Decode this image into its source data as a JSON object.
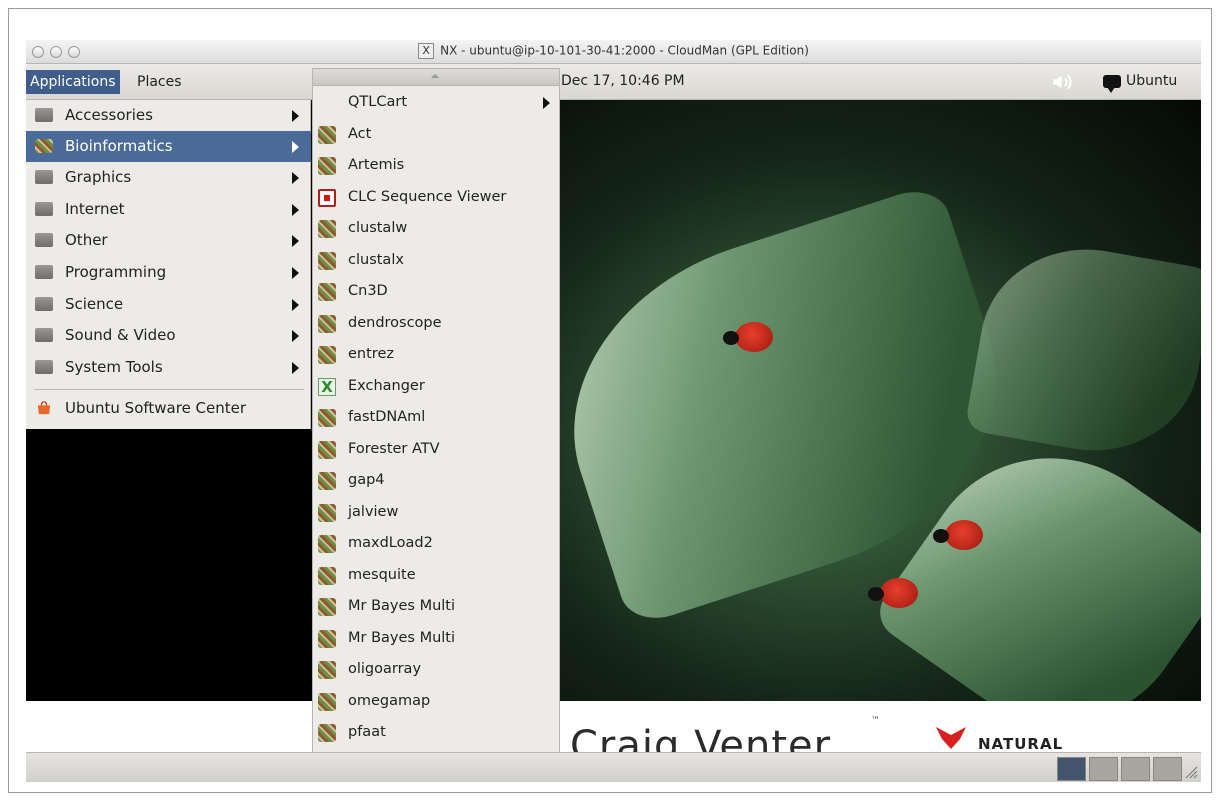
{
  "window": {
    "title": "NX - ubuntu@ip-10-101-30-41:2000 - CloudMan (GPL Edition)"
  },
  "panel": {
    "applications_label": "Applications",
    "places_label": "Places",
    "clock": "Dec 17, 10:46 PM",
    "user": "Ubuntu"
  },
  "app_menu": {
    "items": [
      {
        "label": "Accessories",
        "icon": "accessories-icon",
        "has_submenu": true
      },
      {
        "label": "Bioinformatics",
        "icon": "dna-icon",
        "has_submenu": true,
        "selected": true
      },
      {
        "label": "Graphics",
        "icon": "graphics-icon",
        "has_submenu": true
      },
      {
        "label": "Internet",
        "icon": "internet-icon",
        "has_submenu": true
      },
      {
        "label": "Other",
        "icon": "other-icon",
        "has_submenu": true
      },
      {
        "label": "Programming",
        "icon": "programming-icon",
        "has_submenu": true
      },
      {
        "label": "Science",
        "icon": "science-icon",
        "has_submenu": true
      },
      {
        "label": "Sound & Video",
        "icon": "sound-video-icon",
        "has_submenu": true
      },
      {
        "label": "System Tools",
        "icon": "system-tools-icon",
        "has_submenu": true
      }
    ],
    "software_center": {
      "label": "Ubuntu Software Center",
      "icon": "shopping-bag-icon"
    }
  },
  "bioinformatics_submenu": {
    "items": [
      {
        "label": "QTLCart",
        "icon": "none",
        "has_submenu": true
      },
      {
        "label": "Act",
        "icon": "dna-icon"
      },
      {
        "label": "Artemis",
        "icon": "dna-icon"
      },
      {
        "label": "CLC Sequence Viewer",
        "icon": "clc-icon"
      },
      {
        "label": "clustalw",
        "icon": "dna-icon"
      },
      {
        "label": "clustalx",
        "icon": "dna-icon"
      },
      {
        "label": "Cn3D",
        "icon": "dna-icon"
      },
      {
        "label": "dendroscope",
        "icon": "dna-icon"
      },
      {
        "label": "entrez",
        "icon": "dna-icon"
      },
      {
        "label": "Exchanger",
        "icon": "exchanger-icon"
      },
      {
        "label": "fastDNAml",
        "icon": "dna-icon"
      },
      {
        "label": "Forester ATV",
        "icon": "dna-icon"
      },
      {
        "label": "gap4",
        "icon": "dna-icon"
      },
      {
        "label": "jalview",
        "icon": "dna-icon"
      },
      {
        "label": "maxdLoad2",
        "icon": "dna-icon"
      },
      {
        "label": "mesquite",
        "icon": "dna-icon"
      },
      {
        "label": "Mr Bayes Multi",
        "icon": "dna-icon"
      },
      {
        "label": "Mr Bayes Multi",
        "icon": "dna-icon"
      },
      {
        "label": "oligoarray",
        "icon": "dna-icon"
      },
      {
        "label": "omegamap",
        "icon": "dna-icon"
      },
      {
        "label": "pfaat",
        "icon": "dna-icon"
      }
    ]
  },
  "banner": {
    "text": "Craig Venter",
    "trademark": "™",
    "natural": "NATURAL"
  },
  "colors": {
    "menu_selection": "#4a6a98",
    "active_workspace": "#42556d"
  }
}
